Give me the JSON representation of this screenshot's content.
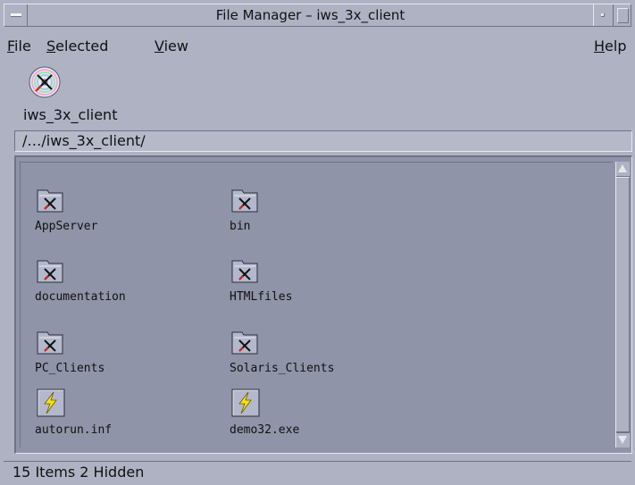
{
  "window": {
    "title": "File Manager – iws_3x_client"
  },
  "menubar": {
    "items": [
      {
        "label": "File",
        "mnemonic": "F",
        "rest": "ile"
      },
      {
        "label": "Selected",
        "mnemonic": "S",
        "rest": "elected"
      },
      {
        "label": "View",
        "mnemonic": "V",
        "rest": "iew"
      },
      {
        "label": "Help",
        "mnemonic": "H",
        "rest": "elp"
      }
    ]
  },
  "object": {
    "label": "iws_3x_client",
    "icon": "cd-disc-icon"
  },
  "path": {
    "value": "/…/iws_3x_client/"
  },
  "files": [
    {
      "name": "AppServer",
      "type": "folder"
    },
    {
      "name": "bin",
      "type": "folder"
    },
    {
      "name": "documentation",
      "type": "folder"
    },
    {
      "name": "HTMLfiles",
      "type": "folder"
    },
    {
      "name": "PC_Clients",
      "type": "folder"
    },
    {
      "name": "Solaris_Clients",
      "type": "folder"
    },
    {
      "name": "autorun.inf",
      "type": "executable"
    },
    {
      "name": "demo32.exe",
      "type": "executable"
    }
  ],
  "status": {
    "text": "15 Items 2 Hidden"
  },
  "colors": {
    "window_bg": "#aeb2c3",
    "file_area_bg": "#8f94a8",
    "folder": "#b4b8cc",
    "exec_bolt": "#f2e21a"
  }
}
